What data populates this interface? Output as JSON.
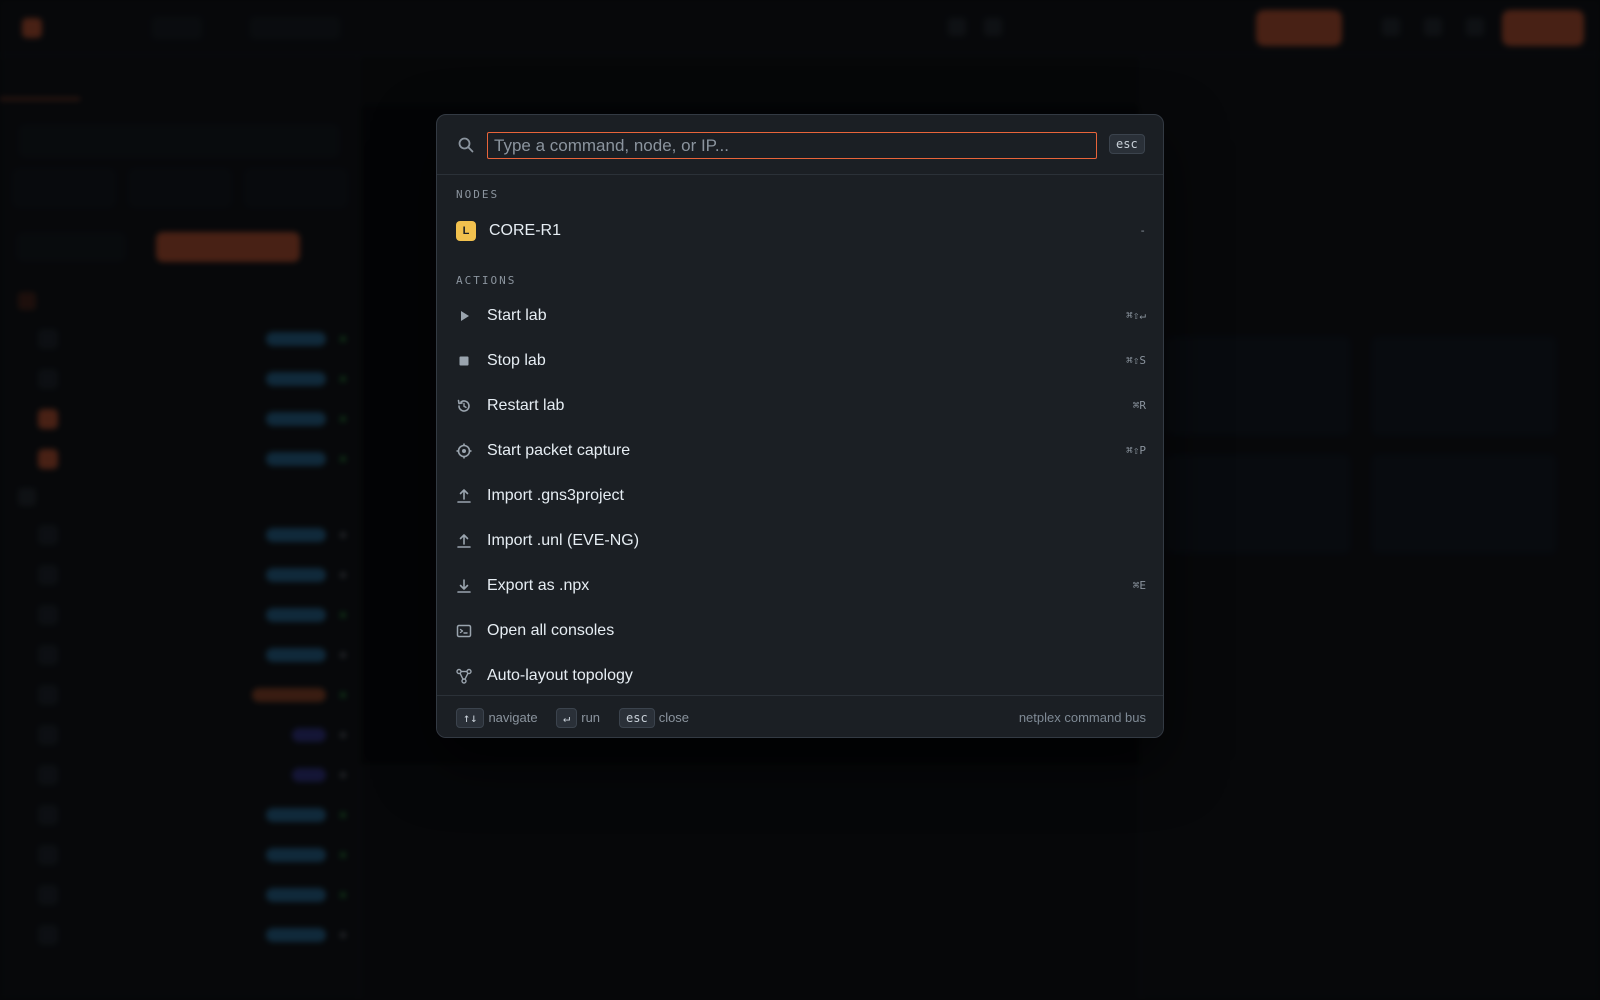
{
  "palette": {
    "search_placeholder": "Type a command, node, or IP...",
    "esc_key": "esc",
    "sections": {
      "nodes": "NODES",
      "actions": "ACTIONS"
    },
    "nodes": [
      {
        "badge": "L",
        "label": "CORE-R1",
        "meta": "-"
      }
    ],
    "actions": [
      {
        "icon": "play-icon",
        "label": "Start lab",
        "shortcut": "⌘⇧↵"
      },
      {
        "icon": "stop-icon",
        "label": "Stop lab",
        "shortcut": "⌘⇧S"
      },
      {
        "icon": "restart-icon",
        "label": "Restart lab",
        "shortcut": "⌘R"
      },
      {
        "icon": "capture-icon",
        "label": "Start packet capture",
        "shortcut": "⌘⇧P"
      },
      {
        "icon": "upload-icon",
        "label": "Import .gns3project",
        "shortcut": ""
      },
      {
        "icon": "upload-icon",
        "label": "Import .unl (EVE-NG)",
        "shortcut": ""
      },
      {
        "icon": "download-icon",
        "label": "Export as .npx",
        "shortcut": "⌘E"
      },
      {
        "icon": "terminal-icon",
        "label": "Open all consoles",
        "shortcut": ""
      },
      {
        "icon": "topology-icon",
        "label": "Auto-layout topology",
        "shortcut": ""
      }
    ],
    "footer": {
      "navigate_key": "↑↓",
      "navigate_label": "navigate",
      "run_key": "↵",
      "run_label": "run",
      "close_key": "esc",
      "close_label": "close",
      "brand": "netplex command bus"
    }
  },
  "colors": {
    "accent": "#e8643a",
    "node_badge": "#f2c14e",
    "palette_bg": "#1b1f24"
  }
}
